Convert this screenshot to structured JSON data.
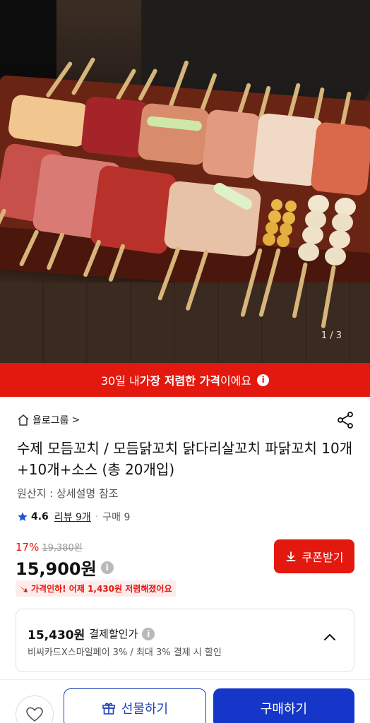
{
  "hero": {
    "page_indicator": "1 / 3"
  },
  "banner": {
    "prefix": "30일 내 ",
    "highlight": "가장 저렴한 가격",
    "suffix": "이에요",
    "info_glyph": "i"
  },
  "store": {
    "name": "욜로그룹",
    "chevron": ">"
  },
  "product": {
    "title": "수제 모듬꼬치 / 모듬닭꼬치 닭다리살꼬치 파닭꼬치 10개+10개+소스 (총 20개입)",
    "origin": "원산지 : 상세설명 참조"
  },
  "rating": {
    "score": "4.6",
    "review_label": "리뷰 9개",
    "separator": "·",
    "sold": "구매 9"
  },
  "pricing": {
    "discount_pct": "17%",
    "original_price": "19,380원",
    "price": "15,900원",
    "info_glyph": "i",
    "coupon_label": "쿠폰받기",
    "price_drop_text": "가격인하! 어제 1,430원 저렴해졌어요"
  },
  "payment_discount": {
    "amount": "15,430원",
    "label": "결제할인가",
    "info_glyph": "i",
    "detail": "비씨카드X스마일페이 3% / 최대 3% 결제 시 할인"
  },
  "bottom_bar": {
    "gift_label": "선물하기",
    "buy_label": "구매하기"
  },
  "colors": {
    "accent_red": "#e3180f",
    "accent_blue": "#1437c9"
  }
}
